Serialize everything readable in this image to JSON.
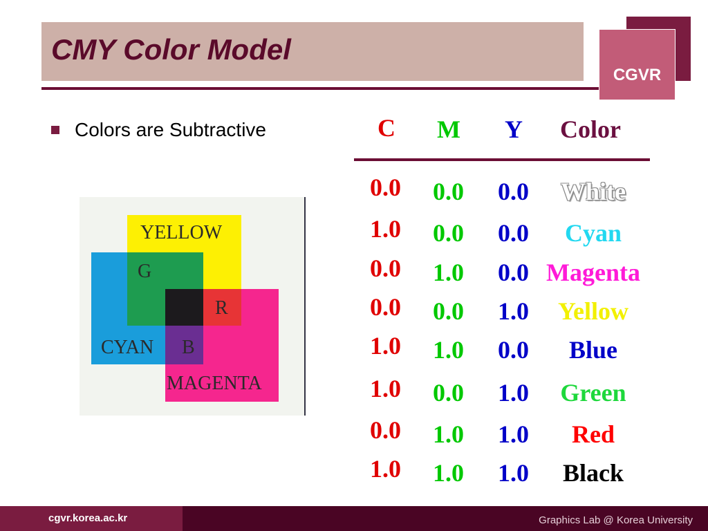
{
  "slide": {
    "title": "CMY Color Model",
    "logo_text": "CGVR",
    "bullet": "Colors are Subtractive"
  },
  "diagram": {
    "labels": {
      "yellow": "YELLOW",
      "g": "G",
      "r": "R",
      "cyan": "CYAN",
      "b": "B",
      "magenta": "MAGENTA"
    },
    "colors": {
      "yellow": "#fdf003",
      "cyan": "#1a9ddb",
      "magenta": "#f5268e",
      "green": "#1e9c50",
      "red": "#e73436",
      "blue": "#6a2e92",
      "black": "#1c1a1d"
    }
  },
  "table": {
    "headers": {
      "c": "C",
      "m": "M",
      "y": "Y",
      "color": "Color"
    },
    "header_colors": {
      "c": "#e00000",
      "m": "#00c800",
      "y": "#0000c8",
      "color": "#6b1040"
    },
    "rows": [
      {
        "c": "0.0",
        "m": "0.0",
        "y": "0.0",
        "color": "White",
        "swatch": "#ffffff"
      },
      {
        "c": "1.0",
        "m": "0.0",
        "y": "0.0",
        "color": "Cyan",
        "swatch": "#22d8f0"
      },
      {
        "c": "0.0",
        "m": "1.0",
        "y": "0.0",
        "color": "Magenta",
        "swatch": "#ff1ad8"
      },
      {
        "c": "0.0",
        "m": "0.0",
        "y": "1.0",
        "color": "Yellow",
        "swatch": "#f2f000"
      },
      {
        "c": "1.0",
        "m": "1.0",
        "y": "0.0",
        "color": "Blue",
        "swatch": "#0000c8"
      },
      {
        "c": "1.0",
        "m": "0.0",
        "y": "1.0",
        "color": "Green",
        "swatch": "#1ed83c"
      },
      {
        "c": "0.0",
        "m": "1.0",
        "y": "1.0",
        "color": "Red",
        "swatch": "#ff0000"
      },
      {
        "c": "1.0",
        "m": "1.0",
        "y": "1.0",
        "color": "Black",
        "swatch": "#000000"
      }
    ]
  },
  "footer": {
    "url": "cgvr.korea.ac.kr",
    "credit": "Graphics Lab @ Korea University"
  }
}
